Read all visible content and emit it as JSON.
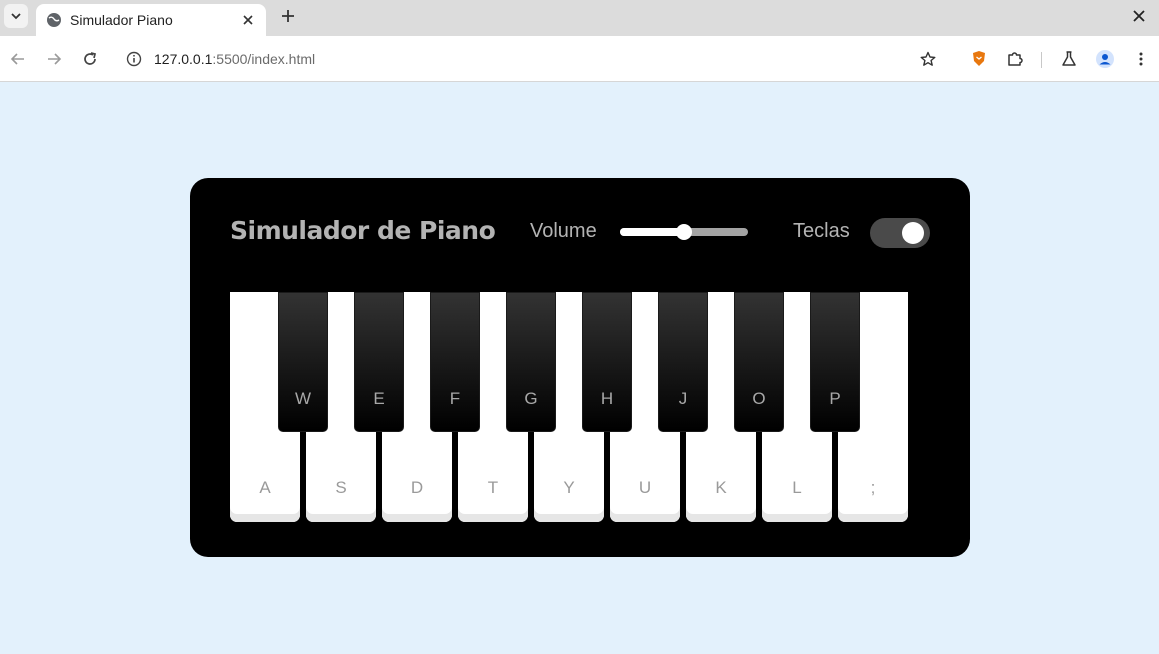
{
  "browser": {
    "tab_title": "Simulador Piano",
    "url_host": "127.0.0.1",
    "url_rest": ":5500/index.html"
  },
  "app": {
    "title": "Simulador de Piano",
    "volume_label": "Volume",
    "volume_value": 0.5,
    "keys_label": "Teclas",
    "keys_toggle_on": true
  },
  "piano": {
    "white_keys": [
      "A",
      "S",
      "D",
      "T",
      "Y",
      "U",
      "K",
      "L",
      ";"
    ],
    "black_keys": [
      "W",
      "E",
      "F",
      "G",
      "H",
      "J",
      "O",
      "P"
    ]
  }
}
